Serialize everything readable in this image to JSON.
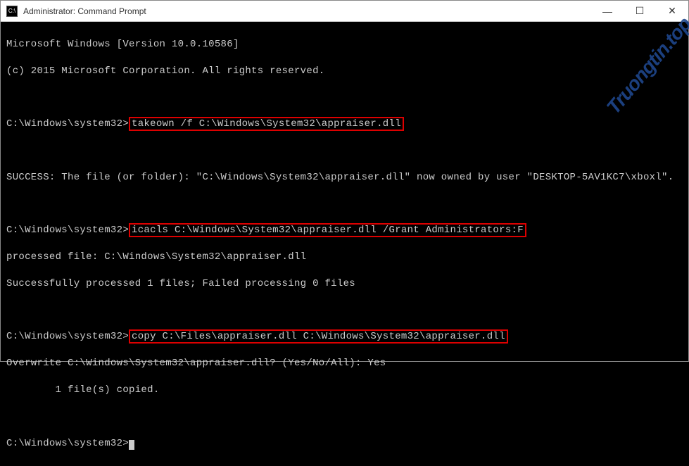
{
  "titlebar": {
    "icon_label": "C:\\",
    "title": "Administrator: Command Prompt"
  },
  "window_controls": {
    "minimize": "—",
    "maximize": "☐",
    "close": "✕"
  },
  "terminal": {
    "header1": "Microsoft Windows [Version 10.0.10586]",
    "header2": "(c) 2015 Microsoft Corporation. All rights reserved.",
    "blank": " ",
    "prompt": "C:\\Windows\\system32>",
    "cmd1": "takeown /f C:\\Windows\\System32\\appraiser.dll",
    "out1": "SUCCESS: The file (or folder): \"C:\\Windows\\System32\\appraiser.dll\" now owned by user \"DESKTOP-5AV1KC7\\xboxl\".",
    "cmd2": "icacls C:\\Windows\\System32\\appraiser.dll /Grant Administrators:F",
    "out2a": "processed file: C:\\Windows\\System32\\appraiser.dll",
    "out2b": "Successfully processed 1 files; Failed processing 0 files",
    "cmd3": "copy C:\\Files\\appraiser.dll C:\\Windows\\System32\\appraiser.dll",
    "out3a": "Overwrite C:\\Windows\\System32\\appraiser.dll? (Yes/No/All): Yes",
    "out3b": "        1 file(s) copied."
  },
  "watermark": "Truongtin.top"
}
